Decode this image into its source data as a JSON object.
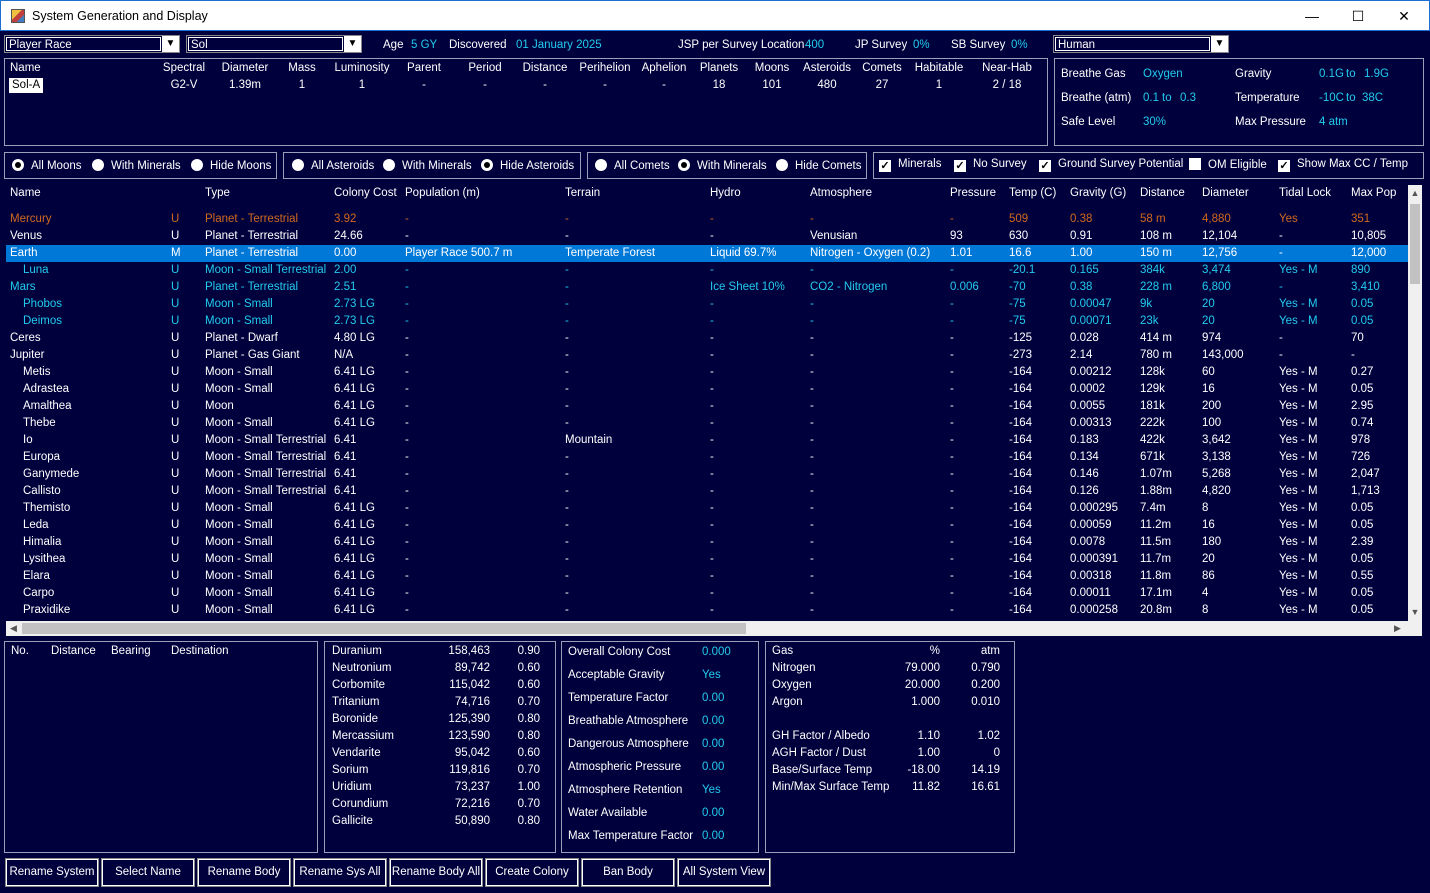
{
  "window": {
    "title": "System Generation and Display",
    "minimize": "—",
    "maximize": "☐",
    "close": "✕"
  },
  "top": {
    "race_combo": "Player Race",
    "system_combo": "Sol",
    "age_label": "Age",
    "age_value": "5 GY",
    "discovered_label": "Discovered",
    "discovered_value": "01 January 2025",
    "jsp_label": "JSP per Survey Location",
    "jsp_value": "400",
    "jp_label": "JP Survey",
    "jp_value": "0%",
    "sb_label": "SB Survey",
    "sb_value": "0%",
    "species_combo": "Human"
  },
  "star": {
    "headers": [
      "Name",
      "Spectral",
      "Diameter",
      "Mass",
      "Luminosity",
      "Parent",
      "Period",
      "Distance",
      "Perihelion",
      "Aphelion",
      "Planets",
      "Moons",
      "Asteroids",
      "Comets",
      "Habitable",
      "Near-Hab"
    ],
    "values": [
      "Sol-A",
      "G2-V",
      "1.39m",
      "1",
      "1",
      "-",
      "-",
      "-",
      "-",
      "-",
      "18",
      "101",
      "480",
      "27",
      "1",
      "2 / 18"
    ]
  },
  "env": {
    "breathe_gas_label": "Breathe Gas",
    "breathe_gas_value": "Oxygen",
    "gravity_label": "Gravity",
    "gravity_min": "0.1G",
    "gravity_to": "to",
    "gravity_max": "1.9G",
    "breathe_atm_label": "Breathe (atm)",
    "breathe_atm_min": "0.1",
    "breathe_atm_to": "to",
    "breathe_atm_max": "0.3",
    "temp_label": "Temperature",
    "temp_min": "-10C",
    "temp_to": "to",
    "temp_max": "38C",
    "safe_label": "Safe Level",
    "safe_value": "30%",
    "maxp_label": "Max Pressure",
    "maxp_value": "4 atm"
  },
  "filters": {
    "moons": [
      "All Moons",
      "With Minerals",
      "Hide Moons"
    ],
    "asteroids": [
      "All Asteroids",
      "With Minerals",
      "Hide Asteroids"
    ],
    "comets": [
      "All Comets",
      "With Minerals",
      "Hide Comets"
    ],
    "checks": [
      "Minerals",
      "No Survey",
      "Ground Survey Potential",
      "OM Eligible",
      "Show Max CC / Temp"
    ]
  },
  "bodies": {
    "headers": [
      "Name",
      "Type",
      "Colony Cost",
      "Population (m)",
      "Terrain",
      "Hydro",
      "Atmosphere",
      "Pressure",
      "Temp (C)",
      "Gravity (G)",
      "Distance",
      "Diameter",
      "Tidal Lock",
      "Max Pop"
    ],
    "rows": [
      {
        "name": "Mercury",
        "indent": false,
        "flag": "U",
        "type": "Planet - Terrestrial",
        "cc": "3.92",
        "pop": "-",
        "terrain": "-",
        "hydro": "-",
        "atm": "-",
        "pres": "-",
        "temp": "509",
        "grav": "0.38",
        "dist": "58 m",
        "diam": "4,880",
        "tidal": "Yes",
        "maxpop": "351",
        "color": "#d2691e"
      },
      {
        "name": "Venus",
        "indent": false,
        "flag": "U",
        "type": "Planet - Terrestrial",
        "cc": "24.66",
        "pop": "-",
        "terrain": "-",
        "hydro": "-",
        "atm": "Venusian",
        "pres": "93",
        "temp": "630",
        "grav": "0.91",
        "dist": "108 m",
        "diam": "12,104",
        "tidal": "-",
        "maxpop": "10,805",
        "color": "#ffffff"
      },
      {
        "name": "Earth",
        "indent": false,
        "flag": "M",
        "type": "Planet - Terrestrial",
        "cc": "0.00",
        "pop": "Player Race 500.7 m",
        "terrain": "Temperate Forest",
        "hydro": "Liquid 69.7%",
        "atm": "Nitrogen - Oxygen (0.2)",
        "pres": "1.01",
        "temp": "16.6",
        "grav": "1.00",
        "dist": "150 m",
        "diam": "12,756",
        "tidal": "-",
        "maxpop": "12,000",
        "color": "#ffffff",
        "selected": true
      },
      {
        "name": "Luna",
        "indent": true,
        "flag": "U",
        "type": "Moon - Small Terrestrial",
        "cc": "2.00",
        "pop": "-",
        "terrain": "-",
        "hydro": "-",
        "atm": "-",
        "pres": "-",
        "temp": "-20.1",
        "grav": "0.165",
        "dist": "384k",
        "diam": "3,474",
        "tidal": "Yes - M",
        "maxpop": "890",
        "color": "#22ccee"
      },
      {
        "name": "Mars",
        "indent": false,
        "flag": "U",
        "type": "Planet - Terrestrial",
        "cc": "2.51",
        "pop": "-",
        "terrain": "-",
        "hydro": "Ice Sheet 10%",
        "atm": "CO2 - Nitrogen",
        "pres": "0.006",
        "temp": "-70",
        "grav": "0.38",
        "dist": "228 m",
        "diam": "6,800",
        "tidal": "-",
        "maxpop": "3,410",
        "color": "#22ccee"
      },
      {
        "name": "Phobos",
        "indent": true,
        "flag": "U",
        "type": "Moon - Small",
        "cc": "2.73 LG",
        "pop": "-",
        "terrain": "-",
        "hydro": "-",
        "atm": "-",
        "pres": "-",
        "temp": "-75",
        "grav": "0.00047",
        "dist": "9k",
        "diam": "20",
        "tidal": "Yes - M",
        "maxpop": "0.05",
        "color": "#22ccee"
      },
      {
        "name": "Deimos",
        "indent": true,
        "flag": "U",
        "type": "Moon - Small",
        "cc": "2.73 LG",
        "pop": "-",
        "terrain": "-",
        "hydro": "-",
        "atm": "-",
        "pres": "-",
        "temp": "-75",
        "grav": "0.00071",
        "dist": "23k",
        "diam": "20",
        "tidal": "Yes - M",
        "maxpop": "0.05",
        "color": "#22ccee"
      },
      {
        "name": "Ceres",
        "indent": false,
        "flag": "U",
        "type": "Planet - Dwarf",
        "cc": "4.80 LG",
        "pop": "-",
        "terrain": "-",
        "hydro": "-",
        "atm": "-",
        "pres": "-",
        "temp": "-125",
        "grav": "0.028",
        "dist": "414 m",
        "diam": "974",
        "tidal": "-",
        "maxpop": "70",
        "color": "#ffffff"
      },
      {
        "name": "Jupiter",
        "indent": false,
        "flag": "U",
        "type": "Planet - Gas Giant",
        "cc": "N/A",
        "pop": "-",
        "terrain": "-",
        "hydro": "-",
        "atm": "-",
        "pres": "-",
        "temp": "-273",
        "grav": "2.14",
        "dist": "780 m",
        "diam": "143,000",
        "tidal": "-",
        "maxpop": "-",
        "color": "#ffffff"
      },
      {
        "name": "Metis",
        "indent": true,
        "flag": "U",
        "type": "Moon - Small",
        "cc": "6.41 LG",
        "pop": "-",
        "terrain": "-",
        "hydro": "-",
        "atm": "-",
        "pres": "-",
        "temp": "-164",
        "grav": "0.00212",
        "dist": "128k",
        "diam": "60",
        "tidal": "Yes - M",
        "maxpop": "0.27",
        "color": "#ffffff"
      },
      {
        "name": "Adrastea",
        "indent": true,
        "flag": "U",
        "type": "Moon - Small",
        "cc": "6.41 LG",
        "pop": "-",
        "terrain": "-",
        "hydro": "-",
        "atm": "-",
        "pres": "-",
        "temp": "-164",
        "grav": "0.0002",
        "dist": "129k",
        "diam": "16",
        "tidal": "Yes - M",
        "maxpop": "0.05",
        "color": "#ffffff"
      },
      {
        "name": "Amalthea",
        "indent": true,
        "flag": "U",
        "type": "Moon",
        "cc": "6.41 LG",
        "pop": "-",
        "terrain": "-",
        "hydro": "-",
        "atm": "-",
        "pres": "-",
        "temp": "-164",
        "grav": "0.0055",
        "dist": "181k",
        "diam": "200",
        "tidal": "Yes - M",
        "maxpop": "2.95",
        "color": "#ffffff"
      },
      {
        "name": "Thebe",
        "indent": true,
        "flag": "U",
        "type": "Moon - Small",
        "cc": "6.41 LG",
        "pop": "-",
        "terrain": "-",
        "hydro": "-",
        "atm": "-",
        "pres": "-",
        "temp": "-164",
        "grav": "0.00313",
        "dist": "222k",
        "diam": "100",
        "tidal": "Yes - M",
        "maxpop": "0.74",
        "color": "#ffffff"
      },
      {
        "name": "Io",
        "indent": true,
        "flag": "U",
        "type": "Moon - Small Terrestrial",
        "cc": "6.41",
        "pop": "-",
        "terrain": "Mountain",
        "hydro": "-",
        "atm": "-",
        "pres": "-",
        "temp": "-164",
        "grav": "0.183",
        "dist": "422k",
        "diam": "3,642",
        "tidal": "Yes - M",
        "maxpop": "978",
        "color": "#ffffff"
      },
      {
        "name": "Europa",
        "indent": true,
        "flag": "U",
        "type": "Moon - Small Terrestrial",
        "cc": "6.41",
        "pop": "-",
        "terrain": "-",
        "hydro": "-",
        "atm": "-",
        "pres": "-",
        "temp": "-164",
        "grav": "0.134",
        "dist": "671k",
        "diam": "3,138",
        "tidal": "Yes - M",
        "maxpop": "726",
        "color": "#ffffff"
      },
      {
        "name": "Ganymede",
        "indent": true,
        "flag": "U",
        "type": "Moon - Small Terrestrial",
        "cc": "6.41",
        "pop": "-",
        "terrain": "-",
        "hydro": "-",
        "atm": "-",
        "pres": "-",
        "temp": "-164",
        "grav": "0.146",
        "dist": "1.07m",
        "diam": "5,268",
        "tidal": "Yes - M",
        "maxpop": "2,047",
        "color": "#ffffff"
      },
      {
        "name": "Callisto",
        "indent": true,
        "flag": "U",
        "type": "Moon - Small Terrestrial",
        "cc": "6.41",
        "pop": "-",
        "terrain": "-",
        "hydro": "-",
        "atm": "-",
        "pres": "-",
        "temp": "-164",
        "grav": "0.126",
        "dist": "1.88m",
        "diam": "4,820",
        "tidal": "Yes - M",
        "maxpop": "1,713",
        "color": "#ffffff"
      },
      {
        "name": "Themisto",
        "indent": true,
        "flag": "U",
        "type": "Moon - Small",
        "cc": "6.41 LG",
        "pop": "-",
        "terrain": "-",
        "hydro": "-",
        "atm": "-",
        "pres": "-",
        "temp": "-164",
        "grav": "0.000295",
        "dist": "7.4m",
        "diam": "8",
        "tidal": "Yes - M",
        "maxpop": "0.05",
        "color": "#ffffff"
      },
      {
        "name": "Leda",
        "indent": true,
        "flag": "U",
        "type": "Moon - Small",
        "cc": "6.41 LG",
        "pop": "-",
        "terrain": "-",
        "hydro": "-",
        "atm": "-",
        "pres": "-",
        "temp": "-164",
        "grav": "0.00059",
        "dist": "11.2m",
        "diam": "16",
        "tidal": "Yes - M",
        "maxpop": "0.05",
        "color": "#ffffff"
      },
      {
        "name": "Himalia",
        "indent": true,
        "flag": "U",
        "type": "Moon - Small",
        "cc": "6.41 LG",
        "pop": "-",
        "terrain": "-",
        "hydro": "-",
        "atm": "-",
        "pres": "-",
        "temp": "-164",
        "grav": "0.0078",
        "dist": "11.5m",
        "diam": "180",
        "tidal": "Yes - M",
        "maxpop": "2.39",
        "color": "#ffffff"
      },
      {
        "name": "Lysithea",
        "indent": true,
        "flag": "U",
        "type": "Moon - Small",
        "cc": "6.41 LG",
        "pop": "-",
        "terrain": "-",
        "hydro": "-",
        "atm": "-",
        "pres": "-",
        "temp": "-164",
        "grav": "0.000391",
        "dist": "11.7m",
        "diam": "20",
        "tidal": "Yes - M",
        "maxpop": "0.05",
        "color": "#ffffff"
      },
      {
        "name": "Elara",
        "indent": true,
        "flag": "U",
        "type": "Moon - Small",
        "cc": "6.41 LG",
        "pop": "-",
        "terrain": "-",
        "hydro": "-",
        "atm": "-",
        "pres": "-",
        "temp": "-164",
        "grav": "0.00318",
        "dist": "11.8m",
        "diam": "86",
        "tidal": "Yes - M",
        "maxpop": "0.55",
        "color": "#ffffff"
      },
      {
        "name": "Carpo",
        "indent": true,
        "flag": "U",
        "type": "Moon - Small",
        "cc": "6.41 LG",
        "pop": "-",
        "terrain": "-",
        "hydro": "-",
        "atm": "-",
        "pres": "-",
        "temp": "-164",
        "grav": "0.00011",
        "dist": "17.1m",
        "diam": "4",
        "tidal": "Yes - M",
        "maxpop": "0.05",
        "color": "#ffffff"
      },
      {
        "name": "Praxidike",
        "indent": true,
        "flag": "U",
        "type": "Moon - Small",
        "cc": "6.41 LG",
        "pop": "-",
        "terrain": "-",
        "hydro": "-",
        "atm": "-",
        "pres": "-",
        "temp": "-164",
        "grav": "0.000258",
        "dist": "20.8m",
        "diam": "8",
        "tidal": "Yes - M",
        "maxpop": "0.05",
        "color": "#ffffff"
      }
    ]
  },
  "jumps": {
    "headers": [
      "No.",
      "Distance",
      "Bearing",
      "Destination"
    ]
  },
  "minerals": [
    {
      "name": "Duranium",
      "amount": "158,463",
      "acc": "0.90"
    },
    {
      "name": "Neutronium",
      "amount": "89,742",
      "acc": "0.60"
    },
    {
      "name": "Corbomite",
      "amount": "115,042",
      "acc": "0.60"
    },
    {
      "name": "Tritanium",
      "amount": "74,716",
      "acc": "0.70"
    },
    {
      "name": "Boronide",
      "amount": "125,390",
      "acc": "0.80"
    },
    {
      "name": "Mercassium",
      "amount": "123,590",
      "acc": "0.80"
    },
    {
      "name": "Vendarite",
      "amount": "95,042",
      "acc": "0.60"
    },
    {
      "name": "Sorium",
      "amount": "119,816",
      "acc": "0.70"
    },
    {
      "name": "Uridium",
      "amount": "73,237",
      "acc": "1.00"
    },
    {
      "name": "Corundium",
      "amount": "72,216",
      "acc": "0.70"
    },
    {
      "name": "Gallicite",
      "amount": "50,890",
      "acc": "0.80"
    }
  ],
  "colony_cost": [
    {
      "label": "Overall Colony Cost",
      "value": "0.000"
    },
    {
      "label": "Acceptable Gravity",
      "value": "Yes"
    },
    {
      "label": "Temperature Factor",
      "value": "0.00"
    },
    {
      "label": "Breathable Atmosphere",
      "value": "0.00"
    },
    {
      "label": "Dangerous Atmosphere",
      "value": "0.00"
    },
    {
      "label": "Atmospheric Pressure",
      "value": "0.00"
    },
    {
      "label": "Atmosphere Retention",
      "value": "Yes"
    },
    {
      "label": "Water Available",
      "value": "0.00"
    },
    {
      "label": "Max Temperature Factor",
      "value": "0.00"
    }
  ],
  "atmosphere": {
    "headers": [
      "Gas",
      "%",
      "atm"
    ],
    "gases": [
      {
        "name": "Nitrogen",
        "pct": "79.000",
        "atm": "0.790"
      },
      {
        "name": "Oxygen",
        "pct": "20.000",
        "atm": "0.200"
      },
      {
        "name": "Argon",
        "pct": "1.000",
        "atm": "0.010"
      }
    ],
    "factors": [
      {
        "name": "GH Factor / Albedo",
        "a": "1.10",
        "b": "1.02"
      },
      {
        "name": "AGH Factor / Dust",
        "a": "1.00",
        "b": "0"
      },
      {
        "name": "Base/Surface Temp",
        "a": "-18.00",
        "b": "14.19"
      },
      {
        "name": "Min/Max Surface Temp",
        "a": "11.82",
        "b": "16.61"
      }
    ]
  },
  "buttons": [
    "Rename System",
    "Select Name",
    "Rename Body",
    "Rename Sys All",
    "Rename Body All",
    "Create Colony",
    "Ban Body",
    "All System View"
  ],
  "colors": {
    "bg": "#00003c",
    "cyan": "#22ccee",
    "selected": "#0078d7",
    "mercury": "#d2691e"
  }
}
